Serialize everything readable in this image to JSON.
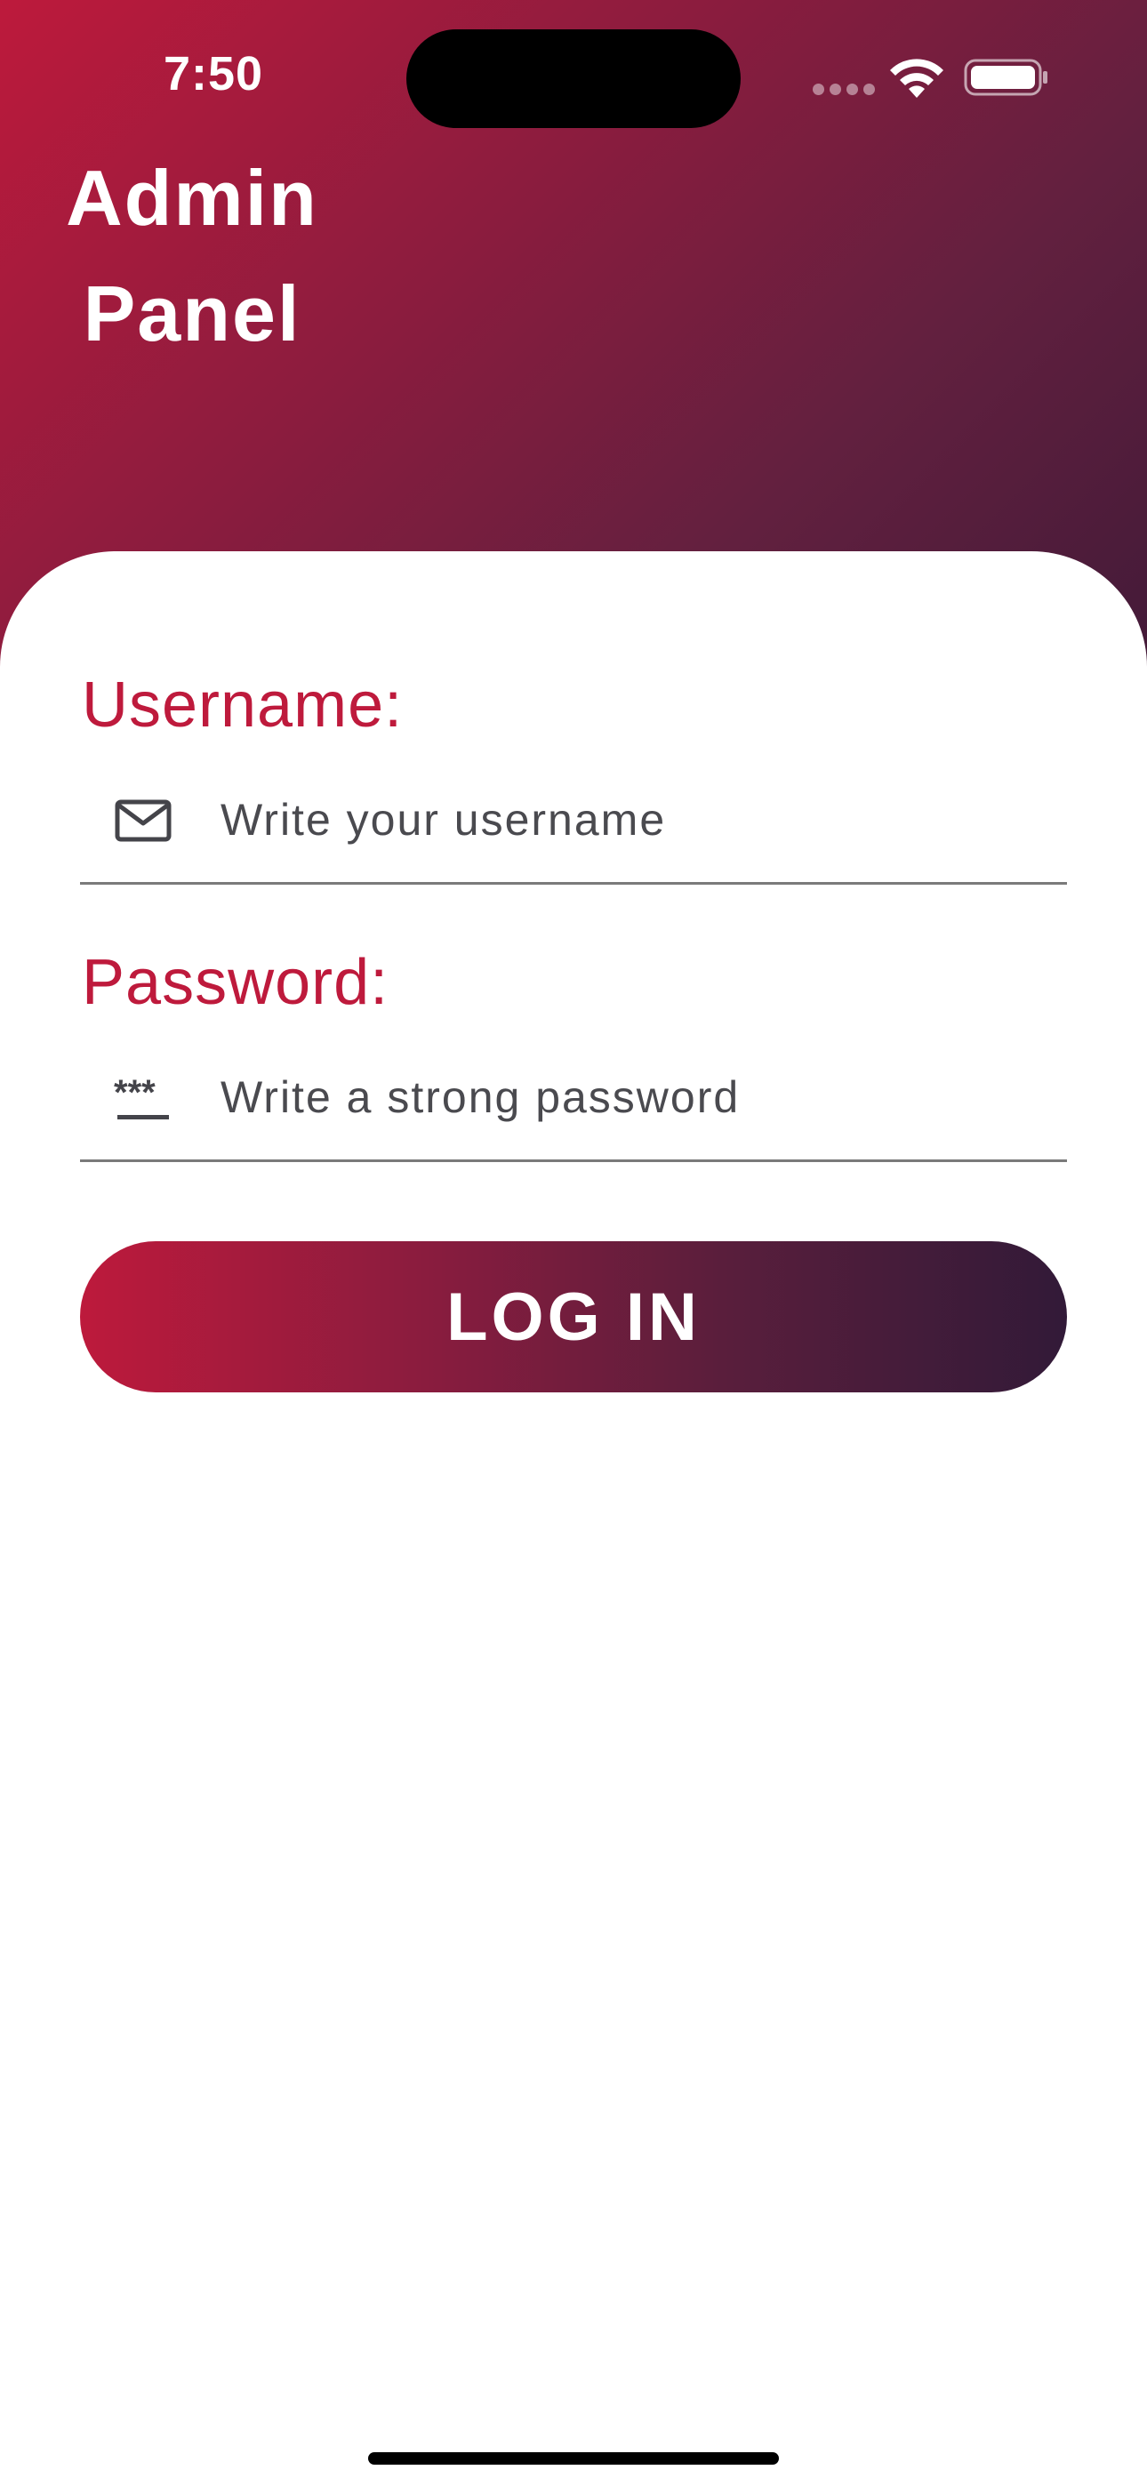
{
  "status_bar": {
    "time": "7:50"
  },
  "header": {
    "title_line1": "Admin",
    "title_line2": "Panel"
  },
  "form": {
    "username": {
      "label": "Username:",
      "placeholder": "Write your username",
      "value": "",
      "icon": "mail-icon"
    },
    "password": {
      "label": "Password:",
      "placeholder": "Write a strong password",
      "value": "",
      "icon": "password-icon"
    },
    "login_label": "LOG IN"
  },
  "colors": {
    "accent": "#be1a3c",
    "gradient_start": "#bd1a3c",
    "gradient_end": "#321a38"
  }
}
